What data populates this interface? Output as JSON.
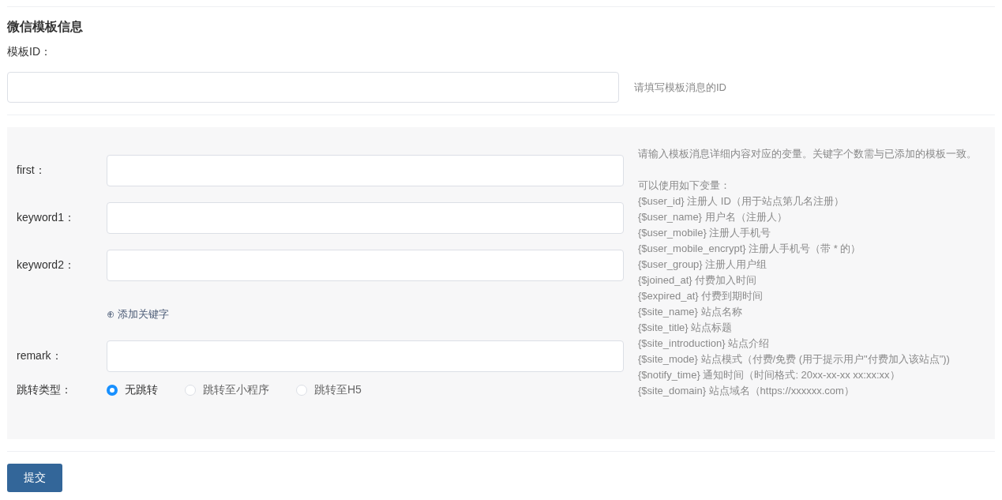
{
  "section_title": "微信模板信息",
  "template_id": {
    "label": "模板ID：",
    "hint": "请填写模板消息的ID"
  },
  "fields": [
    {
      "label": "first："
    },
    {
      "label": "keyword1："
    },
    {
      "label": "keyword2："
    }
  ],
  "add_keyword": {
    "icon": "⊕",
    "label": "添加关键字"
  },
  "remark": {
    "label": "remark："
  },
  "redirect": {
    "label": "跳转类型：",
    "options": [
      {
        "label": "无跳转",
        "selected": true
      },
      {
        "label": "跳转至小程序",
        "selected": false
      },
      {
        "label": "跳转至H5",
        "selected": false
      }
    ]
  },
  "help": {
    "intro": "请输入模板消息详细内容对应的变量。关键字个数需与已添加的模板一致。",
    "heading": "可以使用如下变量：",
    "variables": [
      "{$user_id} 注册人 ID（用于站点第几名注册）",
      "{$user_name} 用户名（注册人）",
      "{$user_mobile} 注册人手机号",
      "{$user_mobile_encrypt} 注册人手机号（带 * 的）",
      "{$user_group} 注册人用户组",
      "{$joined_at} 付费加入时间",
      "{$expired_at} 付费到期时间",
      "{$site_name} 站点名称",
      "{$site_title} 站点标题",
      "{$site_introduction} 站点介绍",
      "{$site_mode} 站点模式（付费/免费 (用于提示用户\"付费加入该站点\"))",
      "{$notify_time} 通知时间（时间格式: 20xx-xx-xx xx:xx:xx）",
      "{$site_domain} 站点域名（https://xxxxxx.com）"
    ]
  },
  "submit": "提交"
}
